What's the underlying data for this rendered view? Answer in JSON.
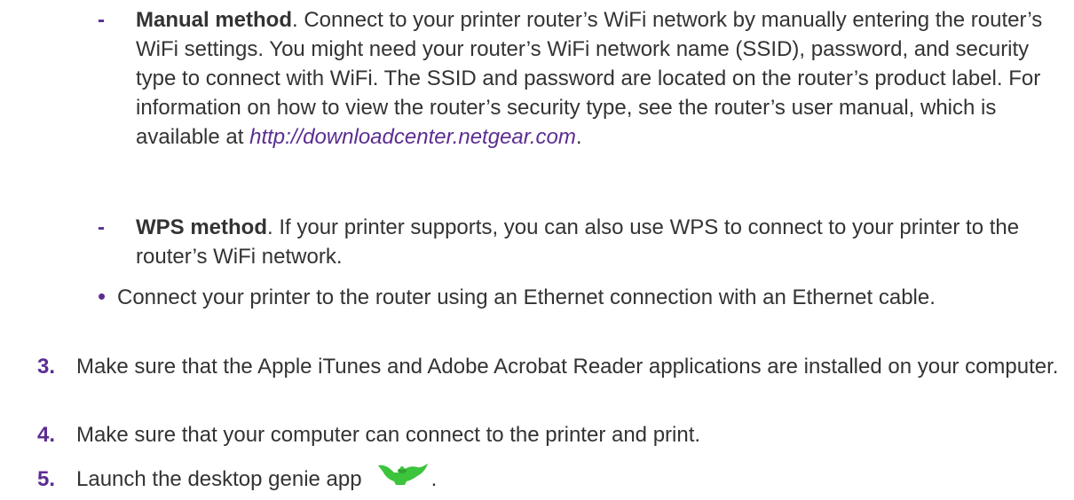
{
  "manual": {
    "marker": "-",
    "title": "Manual method",
    "text_before_link": ". Connect to your printer router’s WiFi network by manually entering the router’s WiFi settings. You might need your router’s WiFi network name (SSID), password, and security type to connect with WiFi. The SSID and password are located on the router’s product label. For information on how to view the router’s security type, see the router’s user manual, which is available at ",
    "link": "http://downloadcenter.netgear.com",
    "text_after_link": "."
  },
  "wps": {
    "marker": "-",
    "title": "WPS method",
    "text": ". If your printer supports, you can also use WPS to connect to your printer to the router’s WiFi network."
  },
  "ethernet_bullet": {
    "marker": "•",
    "text": "Connect your printer to the router using an Ethernet connection with an Ethernet cable."
  },
  "steps": [
    {
      "num": "3.",
      "text": "Make sure that the Apple iTunes and Adobe Acrobat Reader applications are installed on your computer."
    },
    {
      "num": "4.",
      "text": "Make sure that your computer can connect to the printer and print."
    },
    {
      "num": "5.",
      "text": "Launch the desktop genie app",
      "after_icon": "."
    }
  ],
  "icons": {
    "genie_app": "genie-lamp-icon"
  },
  "colors": {
    "accent": "#5c2d91",
    "text": "#333333",
    "genie_green": "#3cc43c"
  }
}
